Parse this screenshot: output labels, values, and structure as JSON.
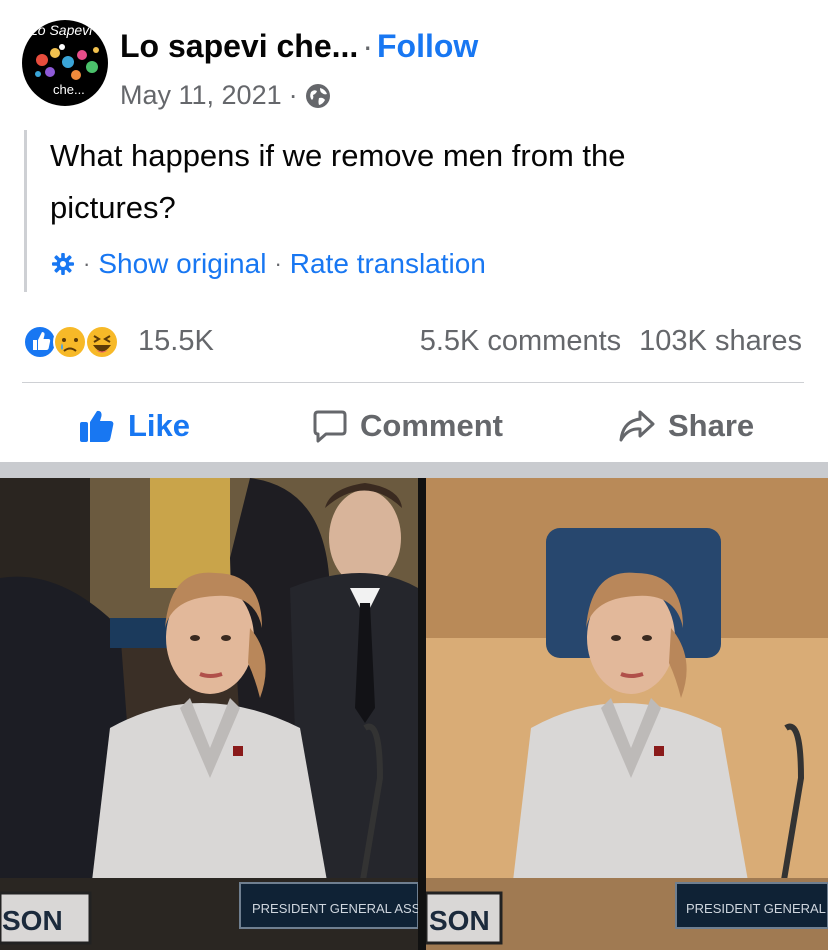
{
  "post": {
    "avatar": {
      "text_top": "Lo Sapevi",
      "text_bottom": "che..."
    },
    "author": "Lo sapevi che...",
    "follow_label": "Follow",
    "date": "May 11, 2021",
    "privacy_icon": "globe-icon",
    "text": "What happens if we remove men from the pictures?",
    "translation": {
      "settings_icon": "gear-icon",
      "show_original": "Show original",
      "rate_translation": "Rate translation"
    }
  },
  "engagement": {
    "reaction_icons": [
      "like-icon",
      "sad-icon",
      "haha-icon"
    ],
    "reactions_count": "15.5K",
    "comments": "5.5K comments",
    "shares": "103K shares"
  },
  "actions": {
    "like": "Like",
    "comment": "Comment",
    "share": "Share"
  },
  "photos": {
    "left_nameplate": "PRESIDENT GENERAL ASS",
    "left_corner_plate": "SON",
    "right_nameplate": "PRESIDENT GENERAL AS",
    "right_corner_plate": "SON"
  },
  "colors": {
    "accent": "#1877f2",
    "secondary_text": "#65676b",
    "divider": "#ced0d4"
  }
}
